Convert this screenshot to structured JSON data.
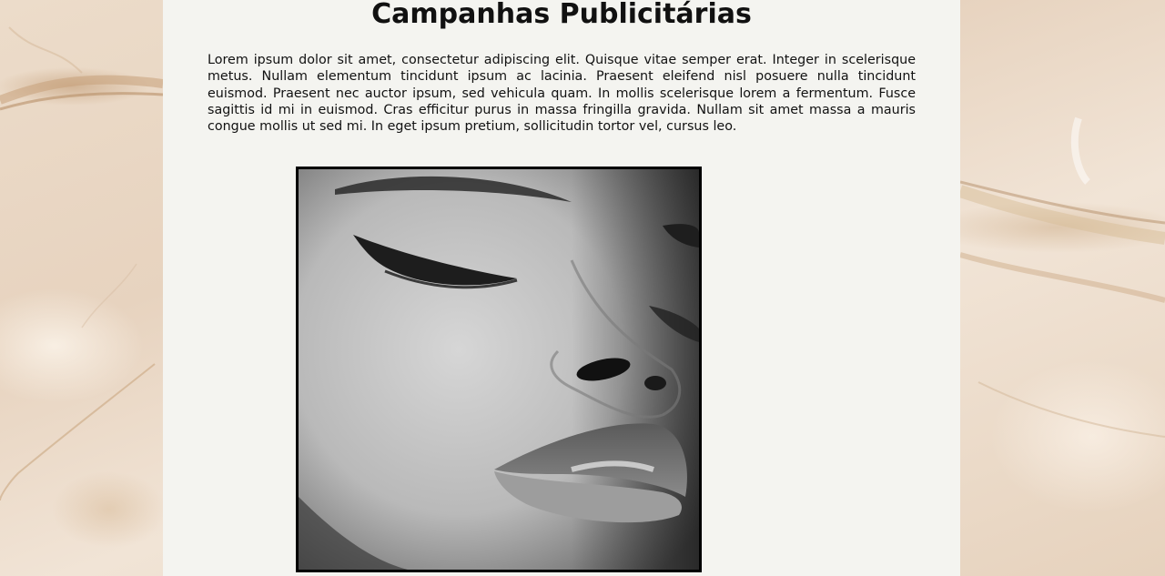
{
  "page": {
    "title": "Campanhas Publicitárias",
    "intro": "Lorem ipsum dolor sit amet, consectetur adipiscing elit. Quisque vitae semper erat. Integer in scelerisque metus. Nullam elementum tincidunt ipsum ac lacinia. Praesent eleifend nisl posuere nulla tincidunt euismod. Praesent nec auctor ipsum, sed vehicula quam. In mollis scelerisque lorem a fermentum. Fusce sagittis id mi in euismod. Cras efficitur purus in massa fringilla gravida. Nullam sit amet massa a mauris congue mollis ut sed mi. In eget ipsum pretium, sollicitudin tortor vel, cursus leo."
  },
  "colors": {
    "panel_background": "#f4f4f0",
    "text": "#111111",
    "photo_border": "#000000",
    "marble_background": "#ecdcca"
  },
  "image": {
    "icon": "portrait-photo-icon"
  }
}
